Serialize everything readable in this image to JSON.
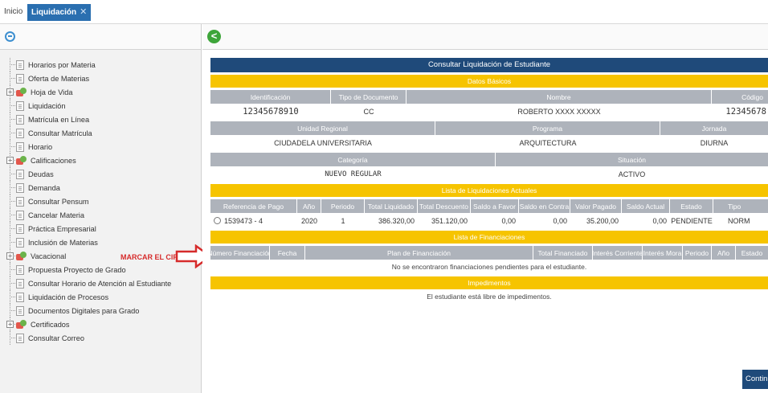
{
  "tabs": {
    "home": "Inicio",
    "active": "Liquidación",
    "close_glyph": "✕"
  },
  "sidebar": {
    "items": [
      {
        "label": "Horarios por Materia",
        "type": "doc"
      },
      {
        "label": "Oferta de Materias",
        "type": "doc"
      },
      {
        "label": "Hoja de Vida",
        "type": "folder"
      },
      {
        "label": "Liquidación",
        "type": "doc"
      },
      {
        "label": "Matrícula en Línea",
        "type": "doc"
      },
      {
        "label": "Consultar Matrícula",
        "type": "doc"
      },
      {
        "label": "Horario",
        "type": "doc"
      },
      {
        "label": "Calificaciones",
        "type": "folder"
      },
      {
        "label": "Deudas",
        "type": "doc"
      },
      {
        "label": "Demanda",
        "type": "doc"
      },
      {
        "label": "Consultar Pensum",
        "type": "doc"
      },
      {
        "label": "Cancelar Materia",
        "type": "doc"
      },
      {
        "label": "Práctica Empresarial",
        "type": "doc"
      },
      {
        "label": "Inclusión de Materias",
        "type": "doc"
      },
      {
        "label": "Vacacional",
        "type": "folder"
      },
      {
        "label": "Propuesta Proyecto de Grado",
        "type": "doc"
      },
      {
        "label": "Consultar Horario de Atención al Estudiante",
        "type": "doc"
      },
      {
        "label": "Liquidación de Procesos",
        "type": "doc"
      },
      {
        "label": "Documentos Digitales para Grado",
        "type": "doc"
      },
      {
        "label": "Certificados",
        "type": "folder"
      },
      {
        "label": "Consultar Correo",
        "type": "doc"
      }
    ],
    "expander_glyph": "+",
    "annotation": "MARCAR EL CIRCULO",
    "annotation_color": "#d62b2b"
  },
  "main": {
    "back_glyph": "<",
    "title": "Consultar Liquidación de Estudiante",
    "datos_basicos": {
      "section": "Datos Básicos",
      "headers1": [
        "Identificación",
        "Tipo de Documento",
        "Nombre",
        "Código"
      ],
      "values1": [
        "12345678910",
        "CC",
        "ROBERTO XXXX XXXXX",
        "12345678"
      ],
      "headers2": [
        "Unidad Regional",
        "Programa",
        "Jornada"
      ],
      "values2": [
        "CIUDADELA UNIVERSITARIA",
        "ARQUITECTURA",
        "DIURNA"
      ],
      "headers3": [
        "Categoría",
        "Situación"
      ],
      "values3": [
        "NUEVO REGULAR",
        "ACTIVO"
      ]
    },
    "liquidaciones": {
      "section": "Lista de Liquidaciones Actuales",
      "headers": [
        "Referencia de Pago",
        "Año",
        "Periodo",
        "Total Liquidado",
        "Total Descuento",
        "Saldo a Favor",
        "Saldo en Contra",
        "Valor Pagado",
        "Saldo Actual",
        "Estado",
        "Tipo"
      ],
      "row": [
        "1539473 - 4",
        "2020",
        "1",
        "386.320,00",
        "351.120,00",
        "0,00",
        "0,00",
        "35.200,00",
        "0,00",
        "PENDIENTE",
        "NORM"
      ]
    },
    "financiaciones": {
      "section": "Lista de Financiaciones",
      "headers": [
        "Número Financiación",
        "Fecha",
        "Plan de Financiación",
        "Total Financiado",
        "Interés Corriente",
        "Interés Mora",
        "Periodo",
        "Año",
        "Estado"
      ],
      "empty_message": "No se encontraron financiaciones pendientes para el estudiante."
    },
    "impedimentos": {
      "section": "Impedimentos",
      "message": "El estudiante está libre de impedimentos."
    },
    "continue_label": "Continuar"
  },
  "colors": {
    "title_bar": "#1f4a7a",
    "section_bar": "#f6c400",
    "header_row": "#aeb3bb",
    "tab_active": "#2a6fb0"
  }
}
